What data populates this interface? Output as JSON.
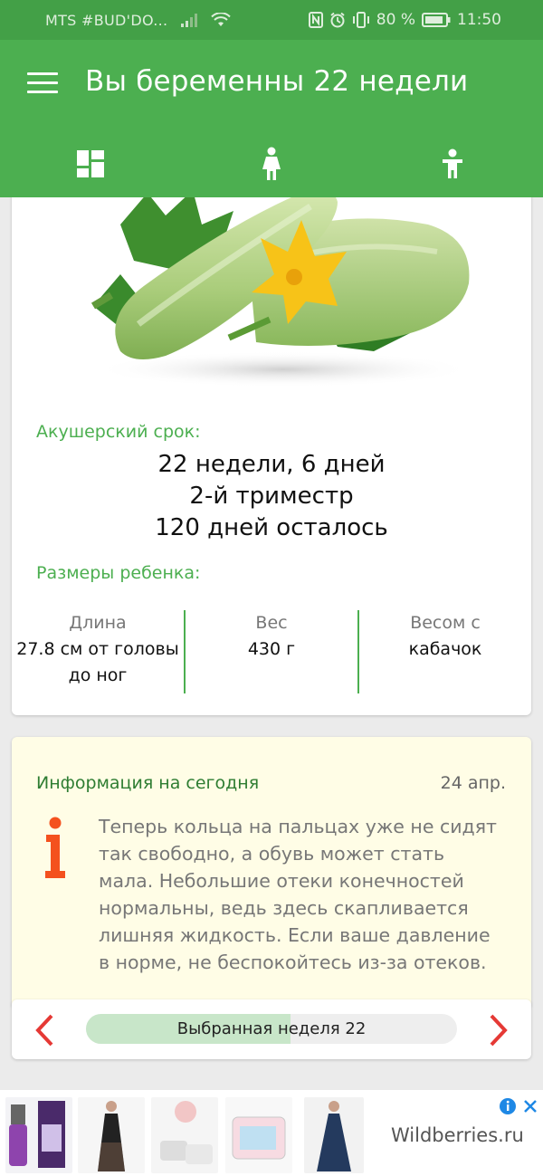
{
  "status_bar": {
    "carrier": "MTS #BUD'DO...",
    "battery_percent": "80 %",
    "time": "11:50",
    "icons": [
      "signal-icon",
      "wifi-icon",
      "nfc-icon",
      "alarm-icon",
      "vibrate-icon",
      "battery-icon"
    ]
  },
  "app_bar": {
    "title": "Вы беременны 22 недели",
    "tabs": [
      "dashboard-icon",
      "woman-icon",
      "child-icon"
    ]
  },
  "term": {
    "label": "Акушерский срок:",
    "duration": "22 недели, 6 дней",
    "trimester": "2-й триместр",
    "remaining": "120 дней осталось"
  },
  "size": {
    "label": "Размеры ребенка:",
    "length": {
      "caption": "Длина",
      "value": "27.8 см от головы до ног"
    },
    "weight": {
      "caption": "Вес",
      "value": "430 г"
    },
    "comparison": {
      "caption": "Весом с",
      "value": "кабачок"
    }
  },
  "info": {
    "title": "Информация на сегодня",
    "date": "24 апр.",
    "text": "Теперь кольца на пальцах уже не сидят так свободно, а обувь может стать мала. Небольшие отеки конечностей нормальны, ведь здесь скапливается лишняя жидкость. Если ваше давление в норме, не беспокойтесь из-за отеков."
  },
  "week_selector": {
    "label": "Выбранная неделя 22",
    "progress_fraction": 0.55
  },
  "ad": {
    "brand": "Wildberries.ru"
  },
  "colors": {
    "primary": "#4caf50",
    "primary_dark": "#43a047",
    "accent_red": "#e53935",
    "info_icon": "#f4511e",
    "info_bg": "#fffde6"
  }
}
